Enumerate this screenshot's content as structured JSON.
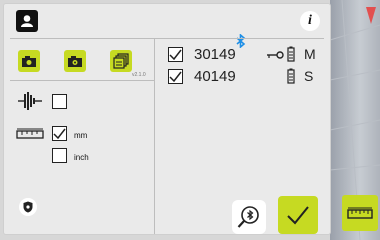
{
  "app": {
    "version": "v2.1.0"
  },
  "header": {
    "user_icon": "user-icon",
    "bluetooth_icon": "bluetooth-icon",
    "info_icon": "info-icon"
  },
  "toolbar": {
    "camera_icon": "camera-icon",
    "camera_alt_icon": "camera-alt-icon",
    "gallery_icon": "gallery-icon"
  },
  "settings": {
    "vibration_checked": false,
    "units_label_mm": "mm",
    "units_label_inch": "inch",
    "mm_checked": true,
    "inch_checked": false
  },
  "devices": [
    {
      "serial": "30149",
      "type": "M",
      "checked": true,
      "has_key": true
    },
    {
      "serial": "40149",
      "type": "S",
      "checked": true,
      "has_key": false
    }
  ],
  "actions": {
    "search_bt_icon": "search-bluetooth-icon",
    "confirm_icon": "check-icon",
    "ruler_icon": "ruler-icon"
  },
  "colors": {
    "accent": "#c6da22",
    "panel": "#eaeaea",
    "side_marker": "#e2504f"
  }
}
